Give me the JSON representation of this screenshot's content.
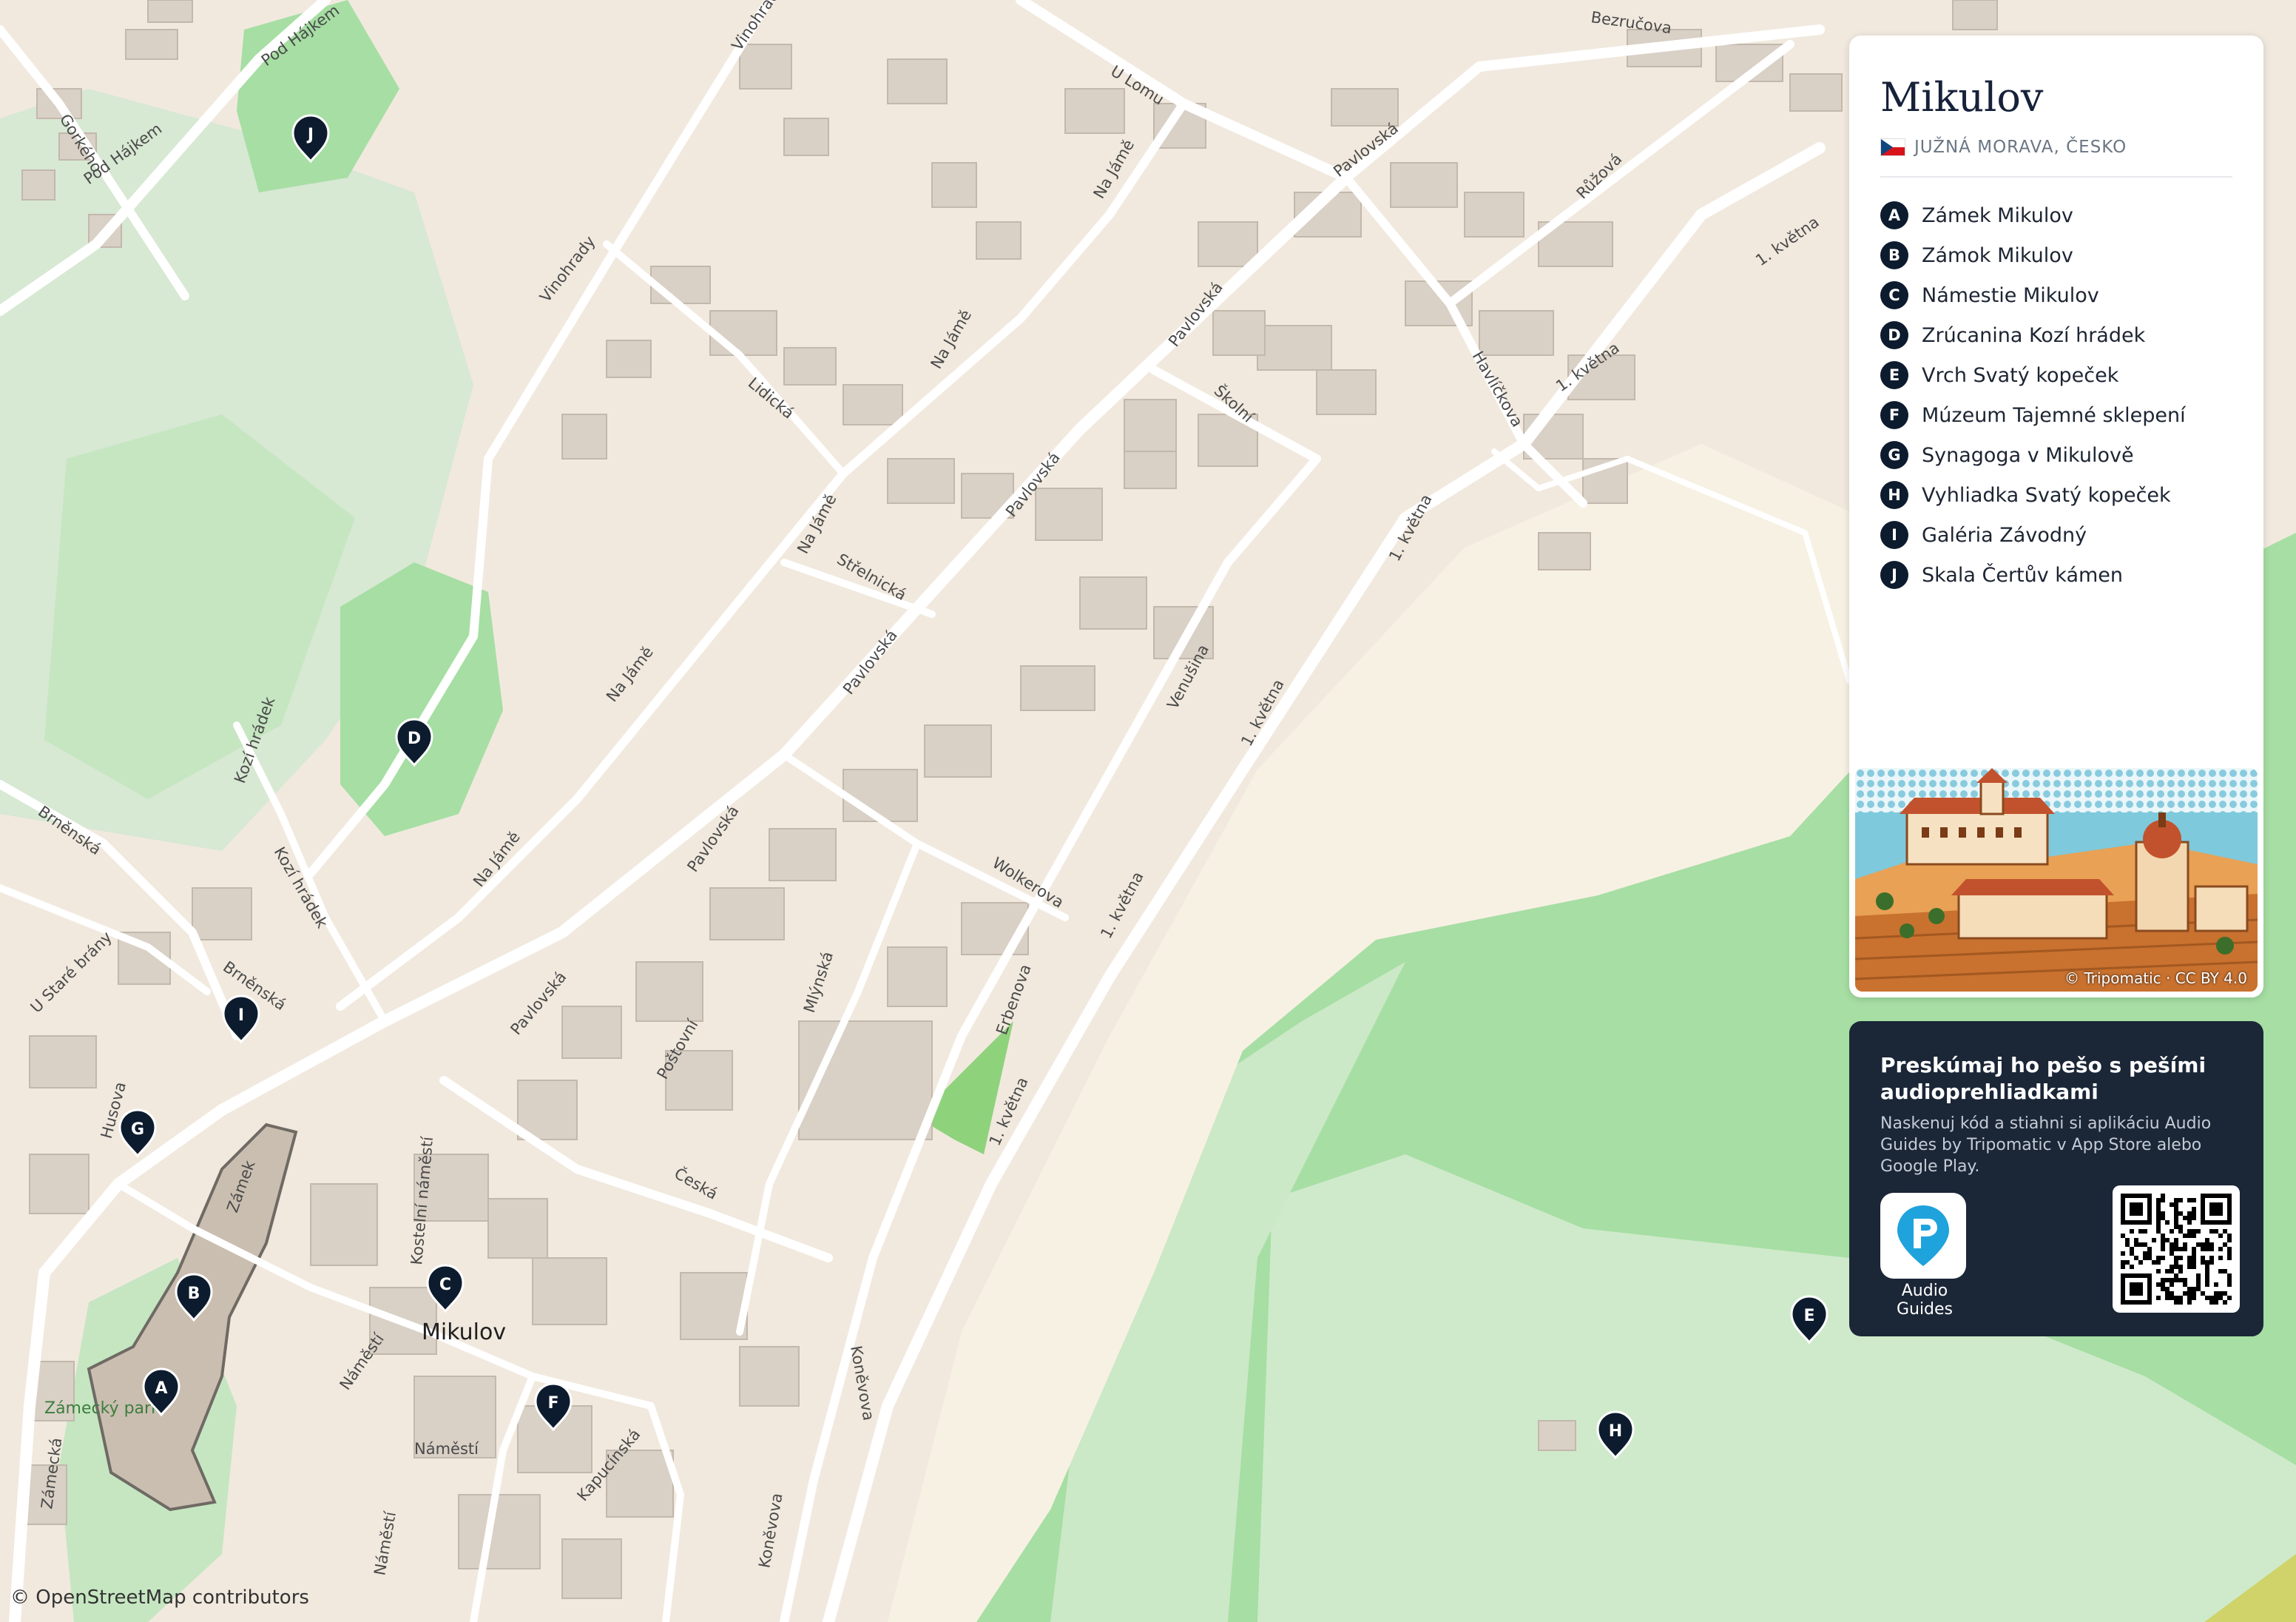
{
  "map": {
    "attribution": "© OpenStreetMap contributors",
    "place_label": "Mikulov",
    "park_label": "Zámecký park",
    "streets": [
      "Pod Hájkem",
      "Gorkého",
      "Vinohrady",
      "U Lomu",
      "Bezručova",
      "Pavlovská",
      "Na Jámě",
      "Lidická",
      "Střelnická",
      "Školní",
      "Růžová",
      "Havlíčkova",
      "1. května",
      "Venušina",
      "Wolkerova",
      "Erbenova",
      "Mlýnská",
      "Poštovní",
      "Česká",
      "Kostelní náměstí",
      "Náměstí",
      "Kapucínská",
      "Koněvova",
      "Zámecká",
      "Zámek",
      "Husova",
      "Brněnská",
      "U Staré brány",
      "Kozí hrádek"
    ],
    "colors": {
      "land": "#f1e9de",
      "building": "#d9d0c6",
      "road": "#ffffff",
      "green": "#a6dea3",
      "light_green": "#cbe8c7",
      "sand": "#f7f1e3",
      "marker": "#0d1b2e"
    }
  },
  "markers": [
    "A",
    "B",
    "C",
    "D",
    "E",
    "F",
    "G",
    "H",
    "I",
    "J"
  ],
  "panel": {
    "title": "Mikulov",
    "region": "JUŽNÁ MORAVA, ČESKO",
    "flag_icon": "czech-flag-icon",
    "pois": [
      {
        "letter": "A",
        "name": "Zámek Mikulov"
      },
      {
        "letter": "B",
        "name": "Zámok Mikulov"
      },
      {
        "letter": "C",
        "name": "Námestie Mikulov"
      },
      {
        "letter": "D",
        "name": "Zrúcanina Kozí hrádek"
      },
      {
        "letter": "E",
        "name": "Vrch Svatý kopeček"
      },
      {
        "letter": "F",
        "name": "Múzeum Tajemné sklepení"
      },
      {
        "letter": "G",
        "name": "Synagoga v Mikulově"
      },
      {
        "letter": "H",
        "name": "Vyhliadka Svatý kopeček"
      },
      {
        "letter": "I",
        "name": "Galéria Závodný"
      },
      {
        "letter": "J",
        "name": "Skala Čertův kámen"
      }
    ],
    "image_credit": "© Tripomatic · CC BY 4.0"
  },
  "promo": {
    "heading": "Preskúmaj ho pešo s pešími audioprehliadkami",
    "body": "Naskenuj kód a stiahni si aplikáciu Audio Guides by Tripomatic v App Store alebo Google Play.",
    "app_label": "Audio Guides",
    "app_icon": "audio-guides-app-icon",
    "qr_icon": "qr-code"
  }
}
